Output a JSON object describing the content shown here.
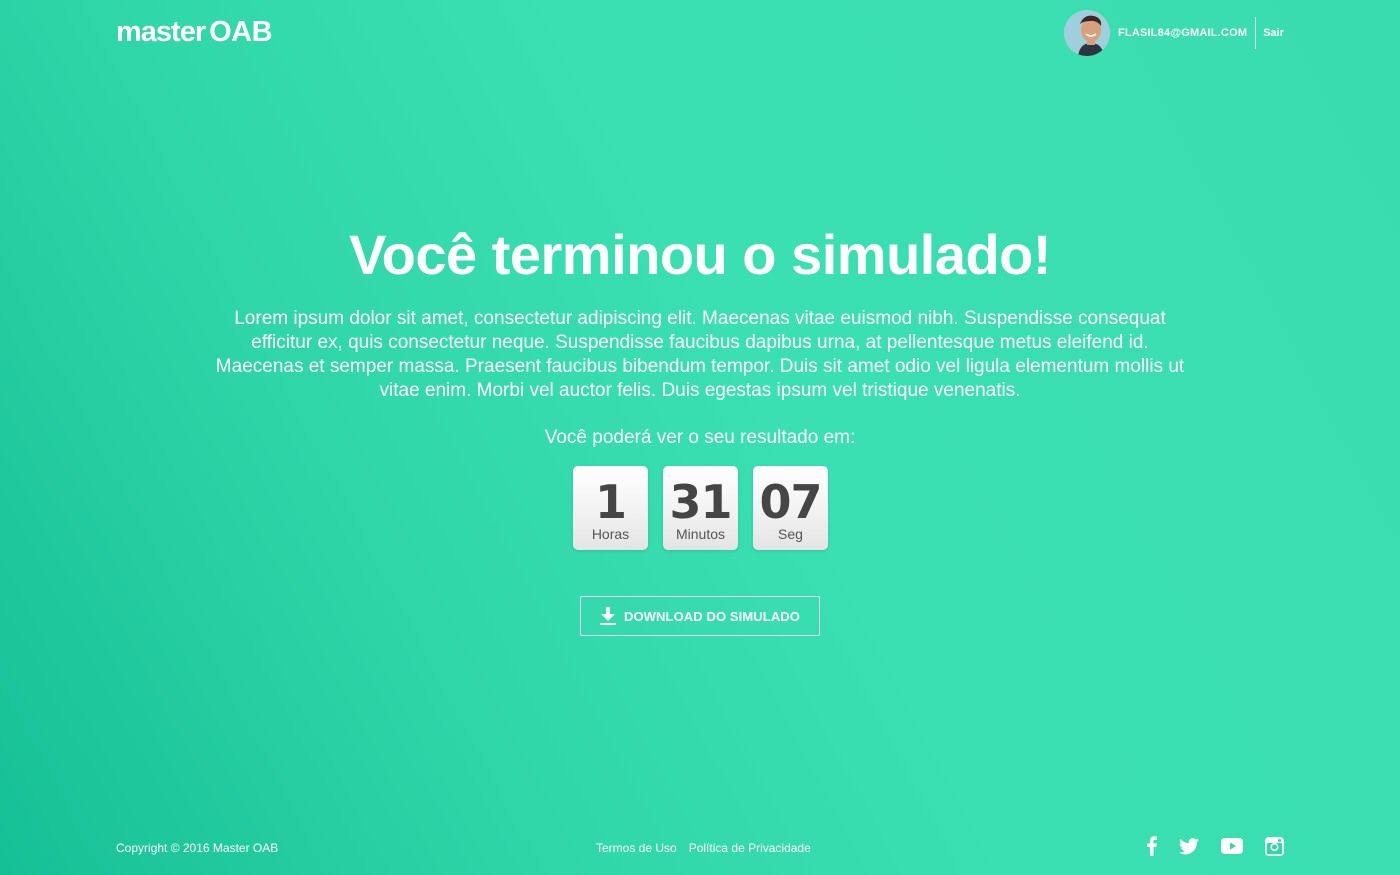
{
  "brand": {
    "logo_part1": "master",
    "logo_part2": "OAB"
  },
  "user": {
    "email": "FLASIL84@GMAIL.COM",
    "logout_label": "Sair"
  },
  "main": {
    "title": "Você terminou o simulado!",
    "description": "Lorem ipsum dolor sit amet, consectetur adipiscing elit. Maecenas vitae euismod nibh. Suspendisse consequat efficitur ex, quis consectetur neque. Suspendisse faucibus dapibus urna, at pellentesque metus eleifend id. Maecenas et semper massa. Praesent faucibus bibendum tempor. Duis sit amet odio vel ligula elementum mollis ut vitae enim. Morbi vel auctor felis. Duis egestas ipsum vel tristique venenatis.",
    "result_label": "Você poderá ver o seu resultado em:",
    "countdown": [
      {
        "value": "1",
        "label": "Horas"
      },
      {
        "value": "31",
        "label": "Minutos"
      },
      {
        "value": "07",
        "label": "Seg"
      }
    ],
    "download_label": "DOWNLOAD DO SIMULADO"
  },
  "footer": {
    "copyright": "Copyright © 2016 Master OAB",
    "links": [
      "Termos de Uso",
      "Política de Privacidade"
    ],
    "social_icons": [
      "facebook-icon",
      "twitter-icon",
      "youtube-icon",
      "instagram-icon"
    ]
  },
  "colors": {
    "background_start": "#16c096",
    "background_end": "#3be0b2",
    "text": "#ffffff",
    "countdown_text": "#454545"
  }
}
